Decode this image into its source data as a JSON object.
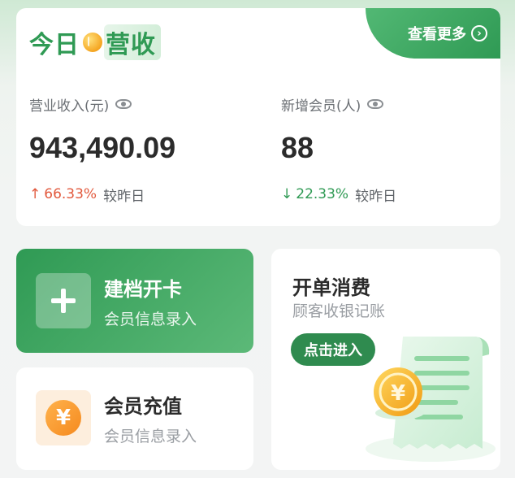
{
  "revenue_card": {
    "title_part1": "今日",
    "title_part2": "营收",
    "more_label": "查看更多",
    "stats": [
      {
        "label": "营业收入(元)",
        "value": "943,490.09",
        "change_arrow": "↑",
        "change": "66.33%",
        "compare": "较昨日",
        "trend": "up"
      },
      {
        "label": "新增会员(人)",
        "value": "88",
        "change_arrow": "↓",
        "change": "22.33%",
        "compare": "较昨日",
        "trend": "down"
      }
    ]
  },
  "open_card": {
    "title": "建档开卡",
    "subtitle": "会员信息录入",
    "icon": "plus-icon"
  },
  "recharge_card": {
    "title": "会员充值",
    "subtitle": "会员信息录入",
    "icon": "yen-icon",
    "icon_glyph": "¥"
  },
  "bill_card": {
    "title": "开单消费",
    "subtitle": "顾客收银记账",
    "button_label": "点击进入",
    "illustration": "receipt-coin-illustration"
  },
  "colors": {
    "brand_green": "#2f9a54",
    "up_red": "#e25a3e",
    "down_green": "#2f9a54",
    "orange": "#f58a1f"
  }
}
